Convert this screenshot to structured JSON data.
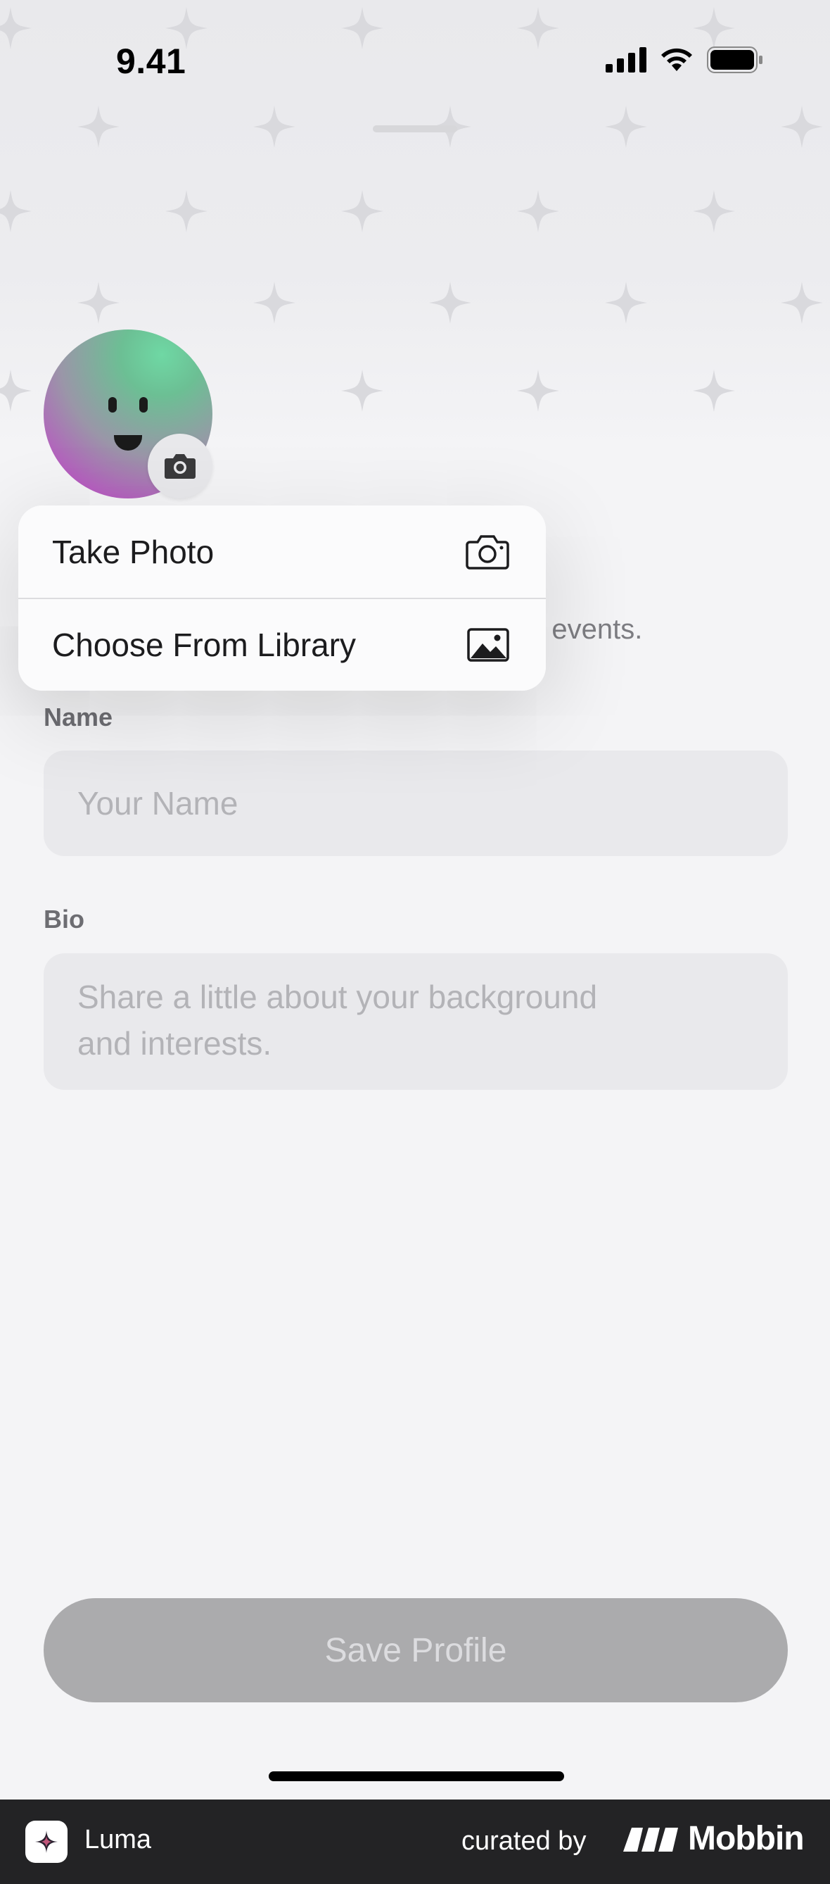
{
  "status_bar": {
    "time": "9.41"
  },
  "menu": {
    "take_photo": "Take Photo",
    "choose_library": "Choose From Library"
  },
  "subtitle_fragment": "r events.",
  "form": {
    "name_label": "Name",
    "name_placeholder": "Your Name",
    "bio_label": "Bio",
    "bio_placeholder_line1": "Share a little about your background",
    "bio_placeholder_line2": "and interests."
  },
  "save_button": "Save Profile",
  "footer": {
    "app_name": "Luma",
    "curated_by": "curated by",
    "brand": "Mobbin"
  },
  "colors": {
    "accent_green": "#6cbf94",
    "accent_purple": "#bb4ec8",
    "button_disabled": "#ababad"
  },
  "icons": {
    "camera": "camera-icon",
    "photo": "photo-icon",
    "signal": "cellular-signal-icon",
    "wifi": "wifi-icon",
    "battery": "battery-icon"
  }
}
